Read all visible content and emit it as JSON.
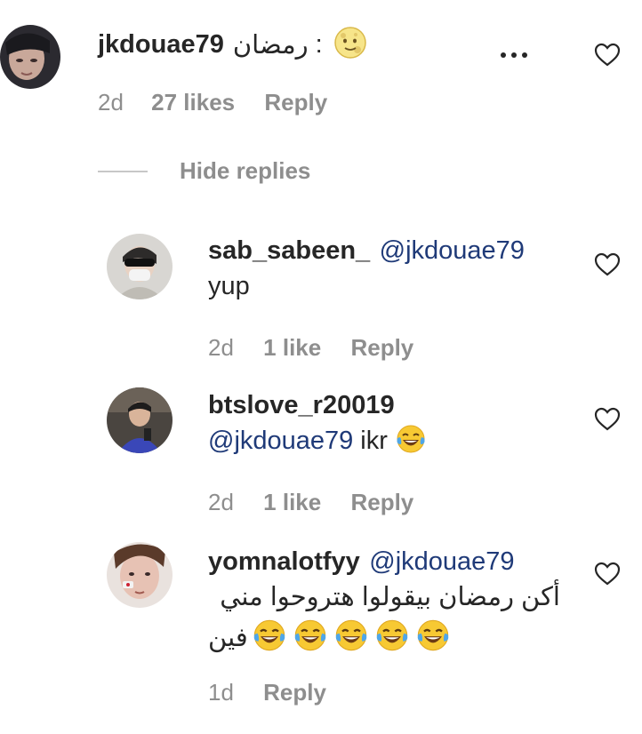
{
  "comment": {
    "username": "jkdouae79",
    "text_arabic": "رمضان",
    "separator": ":",
    "emoji": "full-moon-with-face",
    "time": "2d",
    "likes": "27 likes",
    "reply_label": "Reply",
    "more_label": "•••"
  },
  "thread": {
    "hide_replies_label": "Hide replies"
  },
  "replies": [
    {
      "username": "sab_sabeen_",
      "mention": "@jkdouae79",
      "text": "yup",
      "time": "2d",
      "likes": "1 like",
      "reply_label": "Reply"
    },
    {
      "username": "btslove_r20019",
      "mention": "@jkdouae79",
      "text": "ikr",
      "emoji": "face-with-tears-of-joy",
      "time": "2d",
      "likes": "1 like",
      "reply_label": "Reply"
    },
    {
      "username": "yomnalotfyy",
      "mention": "@jkdouae79",
      "text_line1": "أكن رمضان بيقولوا هتروحوا مني",
      "text_line2": "فين",
      "emoji": "face-with-tears-of-joy",
      "emoji_count": 5,
      "time": "1d",
      "reply_label": "Reply"
    }
  ],
  "colors": {
    "text": "#262626",
    "secondary": "#8e8e8e",
    "mention": "#1f3a78",
    "divider": "#c7c7c7"
  }
}
